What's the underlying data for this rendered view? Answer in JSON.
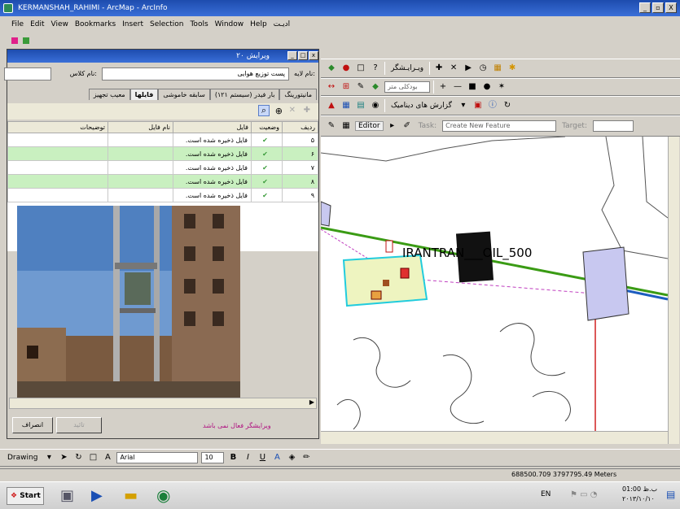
{
  "window": {
    "title": "KERMANSHAH_RAHIMI - ArcMap - ArcInfo",
    "btn_min": "_",
    "btn_max": "▫",
    "btn_close": "X"
  },
  "menu": [
    "File",
    "Edit",
    "View",
    "Bookmarks",
    "Insert",
    "Selection",
    "Tools",
    "Window",
    "Help",
    "ادیـت"
  ],
  "toolbar1": {
    "editor_label": "ویـرایـشگر",
    "scale_value": ""
  },
  "toolbar2": {
    "field": "بودکلی متر"
  },
  "toolbar3": {
    "reports_label": "گزارش های دینامیک",
    "editor_label": "Editor",
    "task_label": "Task:",
    "task_value": "Create New Feature",
    "target_label": "Target:"
  },
  "dialog": {
    "title": "ویرایش ۲۰",
    "layer_name_label": "نام لایه:",
    "layer_name_value": "پست توزیع هوایی",
    "code_label": "نام کلاس:",
    "tabs": [
      "مانیتورینگ",
      "بار فیدر (سیستم ۱۲۱)",
      "سابقه خاموشی",
      "فایلها",
      "معیب تجهیز"
    ],
    "active_tab": "فایلها",
    "columns": [
      "ردیف",
      "وضعیت",
      "فایل",
      "نام فایل",
      "توضیحات"
    ],
    "rows": [
      {
        "no": "۵",
        "file": "فایل ذخیره شده است.",
        "style": "white"
      },
      {
        "no": "۶",
        "file": "فایل ذخیره شده است.",
        "style": "green"
      },
      {
        "no": "۷",
        "file": "فایل ذخیره شده است.",
        "style": "white"
      },
      {
        "no": "۸",
        "file": "فایل ذخیره شده است.",
        "style": "green"
      },
      {
        "no": "۹",
        "file": "فایل ذخیره شده است.",
        "style": "white"
      }
    ],
    "status_msg": "ویرایشگر فعال نمی باشد",
    "cancel_label": "انصراف",
    "ok_label": "تائید"
  },
  "map": {
    "label": "IRANTRAN___OIL_500"
  },
  "drawbar": {
    "drawing_label": "Drawing",
    "font": "Arial",
    "size": "10",
    "bold": "B",
    "italic": "I",
    "underline": "U"
  },
  "status": {
    "coords": "688500.709  3797795.49 Meters"
  },
  "taskbar": {
    "start": "Start",
    "lang": "EN",
    "clock_time": "01:00 ب.ظ",
    "clock_date": "۲۰۱۳/۱۰/۱۰"
  },
  "colors": {
    "titlebar": "#1d4cae",
    "green_row": "#c9f0c0",
    "map_green_line": "#3a9b14",
    "map_blue_line": "#1d5dbf"
  }
}
